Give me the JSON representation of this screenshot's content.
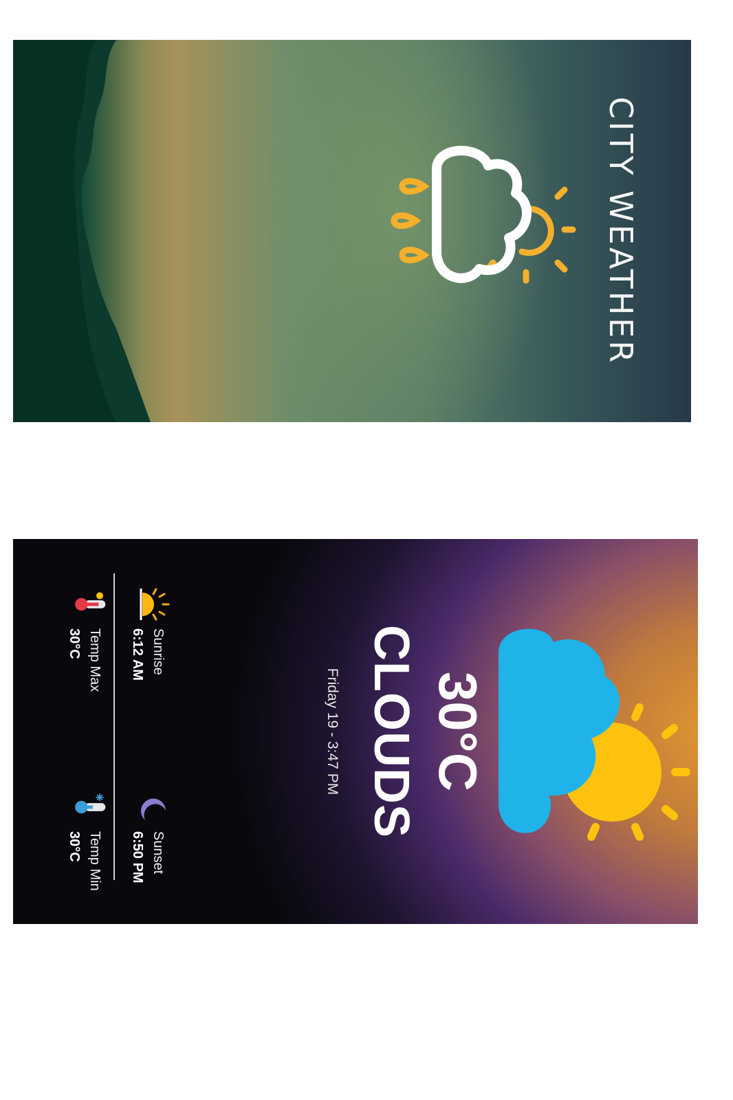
{
  "splash": {
    "app_title": "CITY WEATHER",
    "icon": "cloud-sun-rain-icon"
  },
  "main": {
    "weather_icon": "cloud-sun-icon",
    "temperature": "30°C",
    "condition": "CLOUDS",
    "datetime": "Friday 19 - 3:47 PM",
    "stats": {
      "sunrise": {
        "icon": "sunrise-icon",
        "label": "Sunrise",
        "value": "6:12 AM"
      },
      "sunset": {
        "icon": "moon-icon",
        "label": "Sunset",
        "value": "6:50 PM"
      },
      "temp_max": {
        "icon": "thermometer-hot-icon",
        "label": "Temp Max",
        "value": "30°C"
      },
      "temp_min": {
        "icon": "thermometer-cold-icon",
        "label": "Temp Min",
        "value": "30°C"
      }
    }
  },
  "colors": {
    "cloud_blue": "#1fb3ea",
    "sun_yellow": "#fdc20e",
    "accent_orange": "#f4b02d"
  }
}
